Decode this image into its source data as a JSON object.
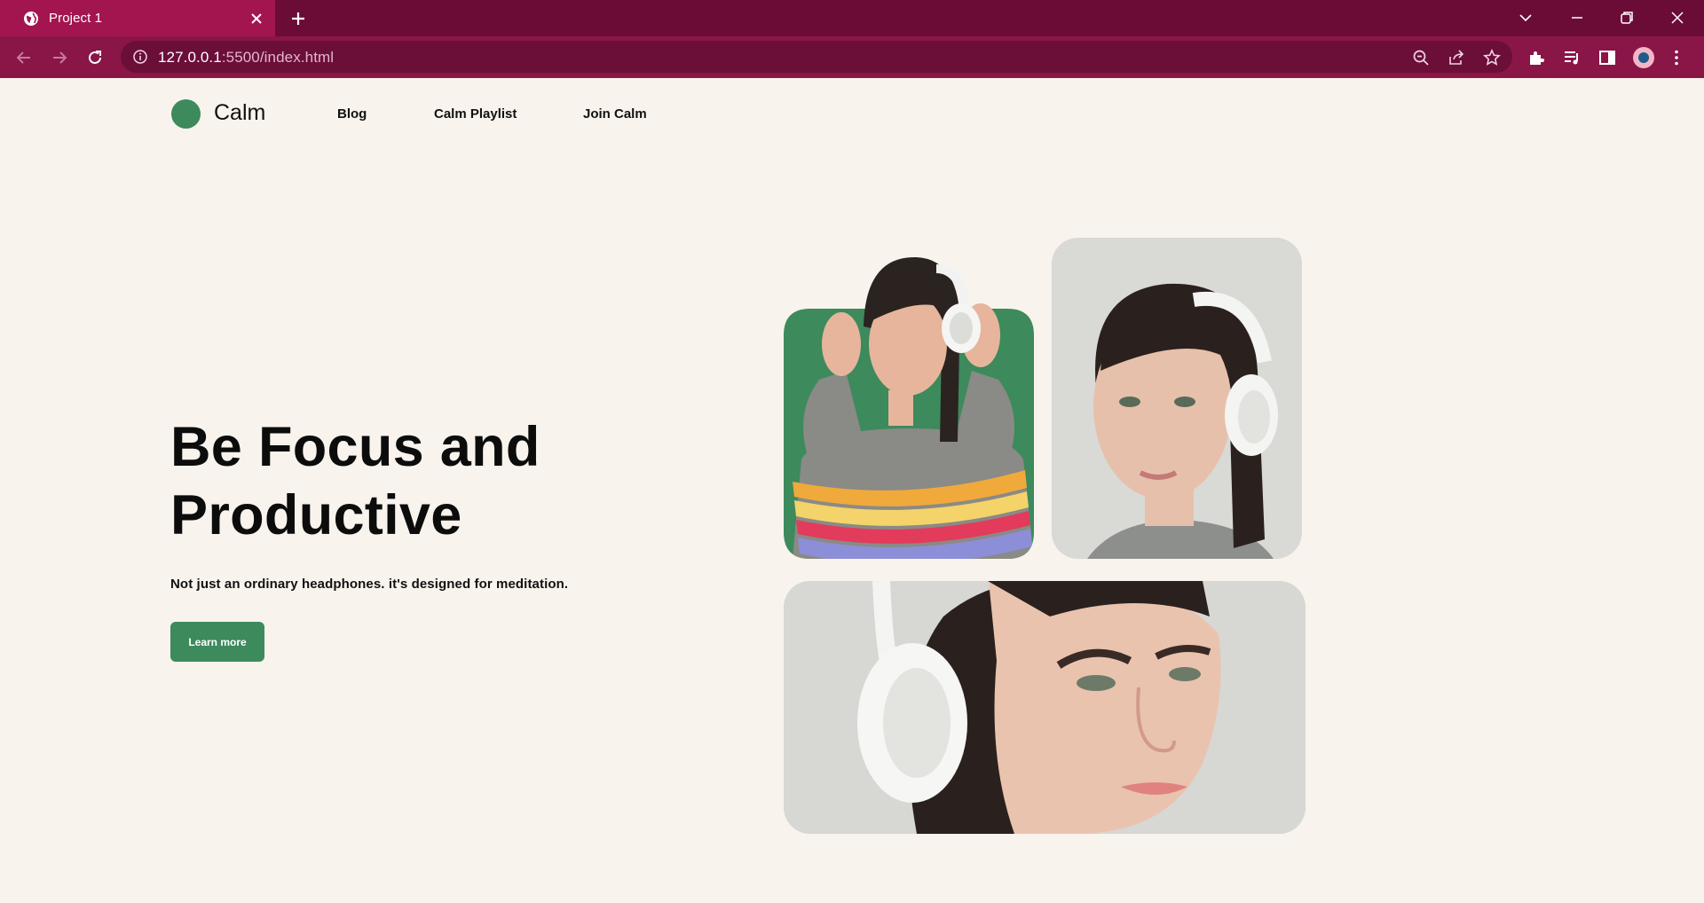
{
  "browser": {
    "tab_title": "Project 1",
    "url_host": "127.0.0.1",
    "url_rest": ":5500/index.html"
  },
  "site": {
    "logo_text": "Calm",
    "nav": [
      {
        "label": "Blog"
      },
      {
        "label": "Calm Playlist"
      },
      {
        "label": "Join Calm"
      }
    ]
  },
  "hero": {
    "title_line1": "Be Focus and",
    "title_line2": "Productive",
    "subtitle": "Not just an ordinary headphones. it's designed for meditation.",
    "cta_label": "Learn more"
  },
  "colors": {
    "brand_green": "#3d8a5c",
    "page_bg": "#f8f3ec",
    "tabbar": "#6a0c36",
    "toolbar": "#8a1547"
  },
  "icons": {
    "tab": "globe-icon",
    "new_tab": "plus-icon",
    "back": "arrow-left-icon",
    "forward": "arrow-right-icon",
    "reload": "reload-icon",
    "zoom": "zoom-out-icon",
    "share": "share-icon",
    "bookmark": "star-icon",
    "extensions": "puzzle-icon",
    "media": "media-queue-icon",
    "sidepanel": "side-panel-icon"
  }
}
